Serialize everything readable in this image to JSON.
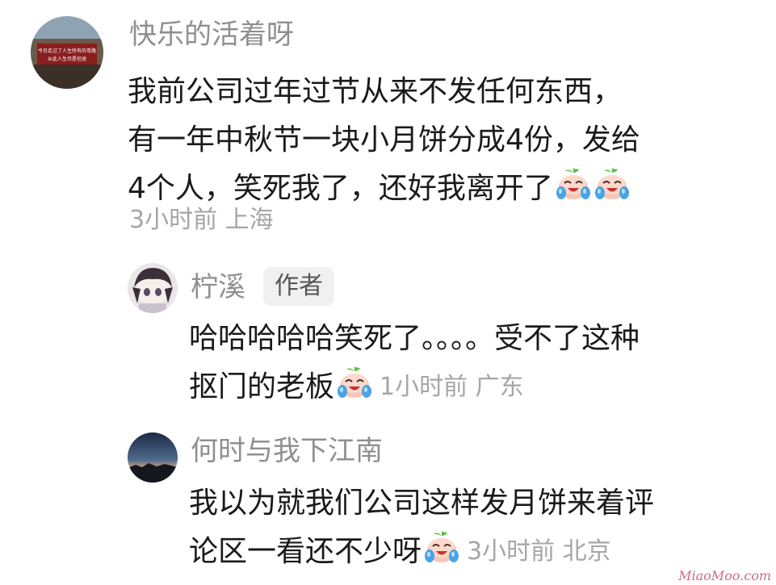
{
  "comments": [
    {
      "username": "快乐的活着呀",
      "lines": [
        "我前公司过年过节从来不发任何东西，",
        "有一年中秋节一块小月饼分成4份，发给",
        "4个人，笑死我了，还好我离开了"
      ],
      "emojis": [
        "crying-laughing-icon",
        "crying-laughing-icon"
      ],
      "meta": "3小时前 上海",
      "avatar_sign_lines": [
        "今日走过了人生所有的弯路",
        "从此人生尽是坦途"
      ]
    },
    {
      "username": "柠溪",
      "badge": "作者",
      "lines": [
        "哈哈哈哈哈笑死了。。。。受不了这种",
        "抠门的老板"
      ],
      "emojis": [
        "crying-laughing-icon"
      ],
      "meta": "1小时前 广东"
    },
    {
      "username": "何时与我下江南",
      "lines": [
        "我以为就我们公司这样发月饼来着评",
        "论区一看还不少呀"
      ],
      "emojis": [
        "crying-laughing-icon"
      ],
      "meta": "3小时前 北京"
    }
  ],
  "watermark": "MiaoMoo.com"
}
